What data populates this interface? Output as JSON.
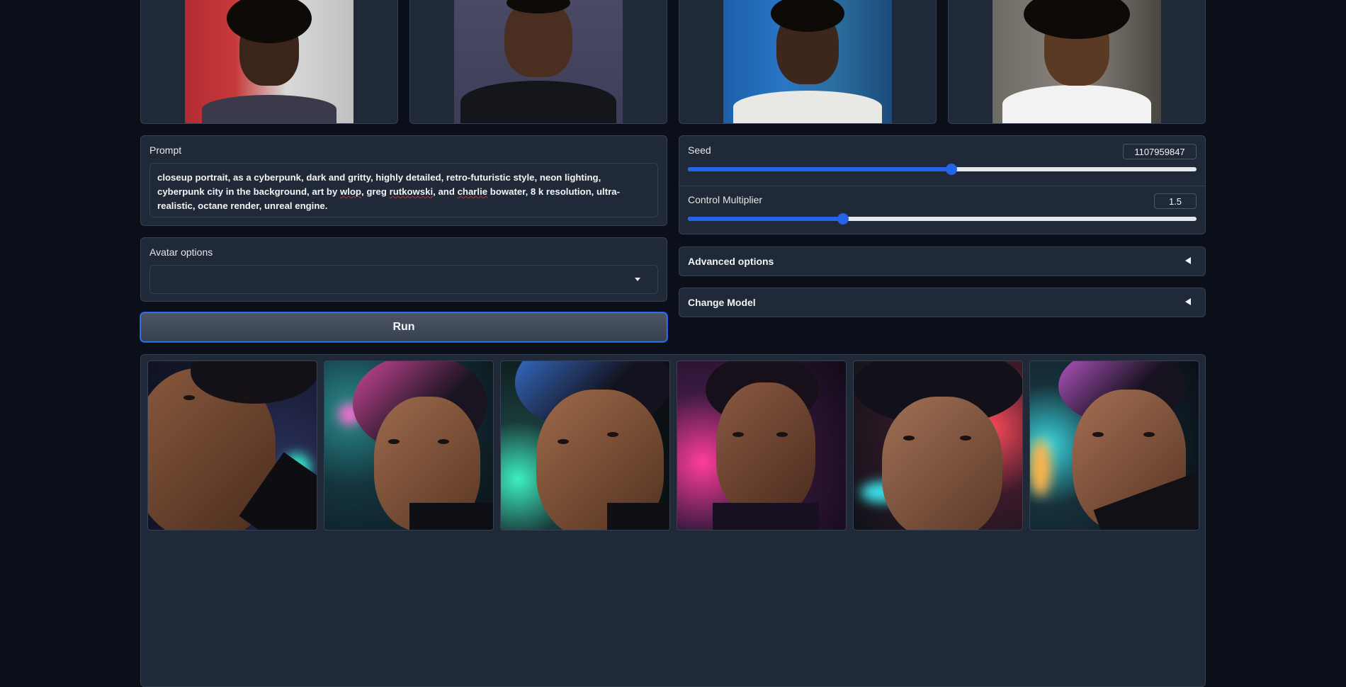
{
  "reference_images": [
    {
      "alt": "reference-photo-1"
    },
    {
      "alt": "reference-photo-2"
    },
    {
      "alt": "reference-photo-3"
    },
    {
      "alt": "reference-photo-4"
    }
  ],
  "prompt": {
    "label": "Prompt",
    "value_parts": [
      "closeup portrait, as a cyberpunk, dark and gritty, highly detailed, retro-futuristic style, neon lighting, cyberpunk city in the background, art by ",
      "wlop",
      ", greg ",
      "rutkowski",
      ", and ",
      "charlie",
      " bowater, 8 k resolution, ultra-realistic, octane render, unreal engine."
    ]
  },
  "avatar_options": {
    "label": "Avatar options",
    "selected": ""
  },
  "run_button": {
    "label": "Run"
  },
  "seed": {
    "label": "Seed",
    "value": "1107959847",
    "fraction": 0.518
  },
  "control_multiplier": {
    "label": "Control Multiplier",
    "value": "1.5",
    "fraction": 0.305
  },
  "advanced_options": {
    "label": "Advanced options"
  },
  "change_model": {
    "label": "Change Model"
  },
  "gallery": [
    {
      "alt": "generated-portrait-1"
    },
    {
      "alt": "generated-portrait-2"
    },
    {
      "alt": "generated-portrait-3"
    },
    {
      "alt": "generated-portrait-4"
    },
    {
      "alt": "generated-portrait-5"
    },
    {
      "alt": "generated-portrait-6"
    }
  ],
  "colors": {
    "background": "#0b0f19",
    "panel": "#1f2937",
    "border": "#374151",
    "accent": "#2563eb"
  }
}
